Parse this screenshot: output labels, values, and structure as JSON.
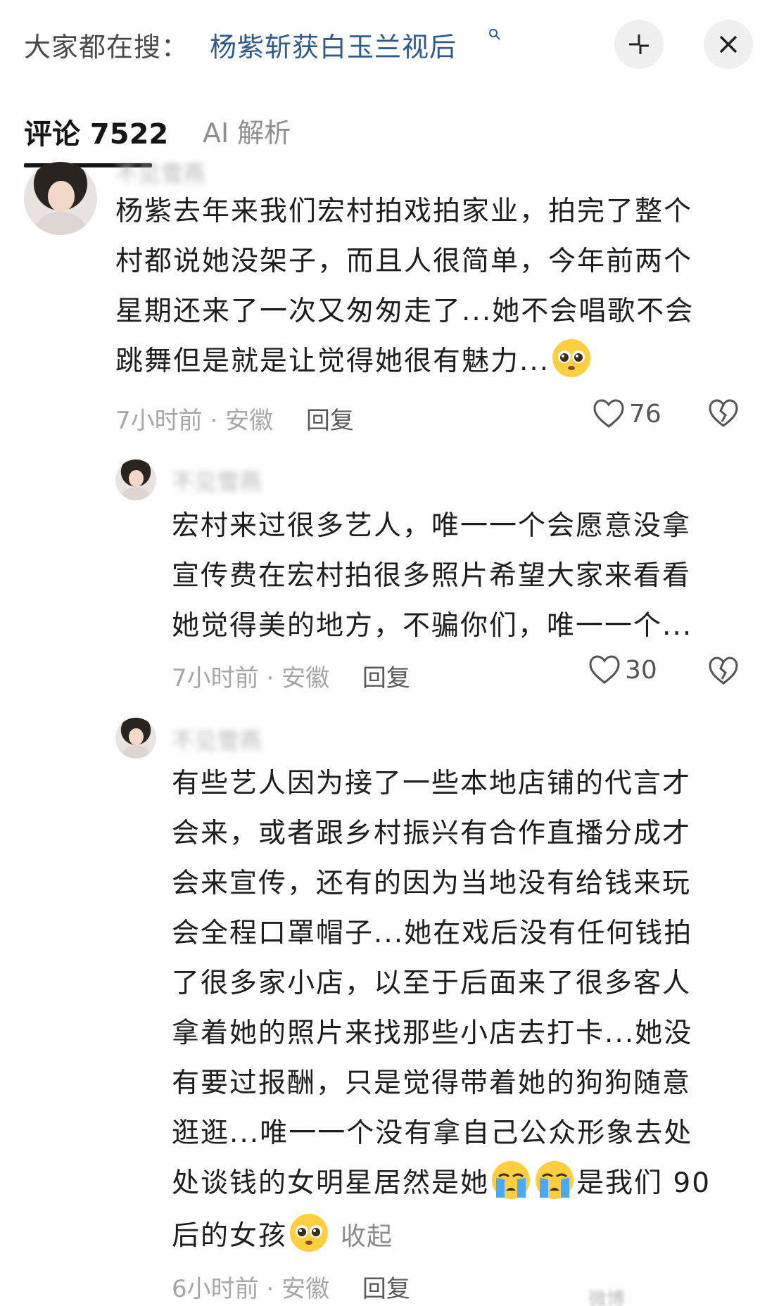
{
  "search": {
    "prefix": "大家都在搜：",
    "term": "杨紫斩获白玉兰视后"
  },
  "tabs": [
    {
      "label": "评论 7522",
      "active": true
    },
    {
      "label": "AI 解析",
      "active": false
    }
  ],
  "comments": [
    {
      "username": "不见雪燕",
      "lines": [
        "杨紫去年来我们宏村拍戏拍家业，拍完了整个",
        "村都说她没架子，而且人很简单，今年前两个",
        "星期还来了一次又匆匆走了...她不会唱歌不会",
        "跳舞但是就是让觉得她很有魅力..."
      ],
      "time": "7小时前",
      "location": "安徽",
      "reply_label": "回复",
      "likes": "76"
    },
    {
      "username": "不见雪燕",
      "lines": [
        "宏村来过很多艺人，唯一一个会愿意没拿",
        "宣传费在宏村拍很多照片希望大家来看看",
        "她觉得美的地方，不骗你们，唯一一个..."
      ],
      "time": "7小时前",
      "location": "安徽",
      "reply_label": "回复",
      "likes": "30"
    },
    {
      "username": "不见雪燕",
      "lines": [
        "有些艺人因为接了一些本地店铺的代言才",
        "会来，或者跟乡村振兴有合作直播分成才",
        "会来宣传，还有的因为当地没有给钱来玩",
        "会全程口罩帽子...她在戏后没有任何钱拍",
        "了很多家小店，以至于后面来了很多客人",
        "拿着她的照片来找那些小店去打卡...她没",
        "有要过报酬，只是觉得带着她的狗狗随意",
        "逛逛...唯一一个没有拿自己公众形象去处",
        "处谈钱的女明星居然是她",
        "后的女孩"
      ],
      "line9_suffix": "是我们 90",
      "collapse_label": "收起",
      "time": "6小时前",
      "location": "安徽",
      "reply_label": "回复"
    }
  ],
  "meta_separator": "·",
  "watermark": "微博"
}
